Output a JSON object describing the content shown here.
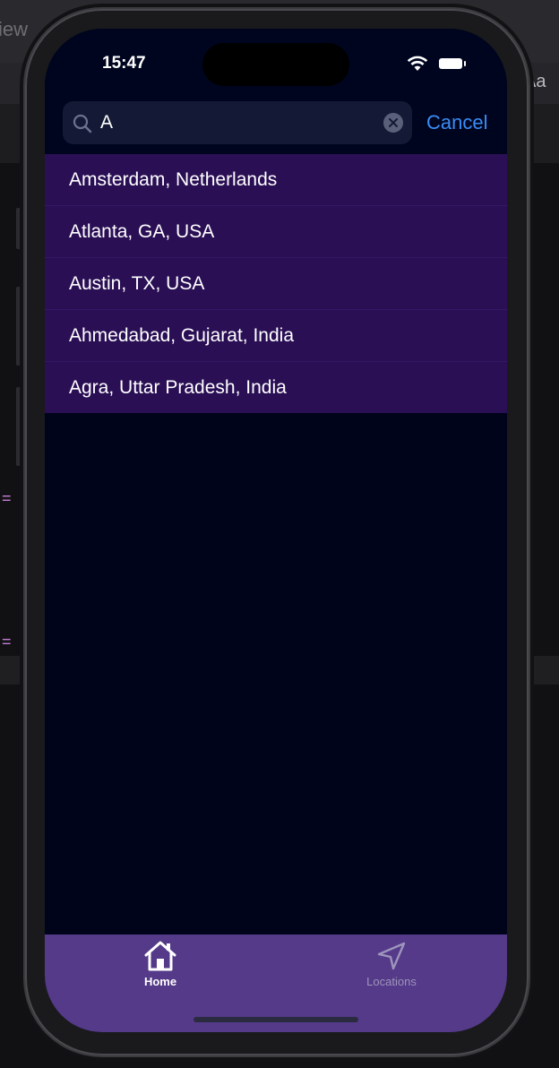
{
  "background": {
    "left_text": "iew",
    "right_text": "Aa",
    "markers": [
      "=",
      "="
    ]
  },
  "status_bar": {
    "time": "15:47",
    "wifi_icon": "wifi-icon",
    "battery_icon": "battery-icon"
  },
  "search": {
    "value": "A",
    "cancel_label": "Cancel",
    "search_icon": "magnifying-glass-icon",
    "clear_icon": "clear-x-icon"
  },
  "results": [
    {
      "label": "Amsterdam, Netherlands"
    },
    {
      "label": "Atlanta, GA, USA"
    },
    {
      "label": "Austin, TX, USA"
    },
    {
      "label": "Ahmedabad, Gujarat, India"
    },
    {
      "label": "Agra, Uttar Pradesh, India"
    }
  ],
  "tabbar": {
    "tabs": [
      {
        "label": "Home",
        "icon": "house-icon",
        "selected": true
      },
      {
        "label": "Locations",
        "icon": "location-arrow-icon",
        "selected": false
      }
    ]
  },
  "colors": {
    "accent": "#3a8cf5",
    "results_bg": "#2a0f55",
    "tabbar_bg": "#543a88",
    "screen_bg": "#00041b"
  }
}
